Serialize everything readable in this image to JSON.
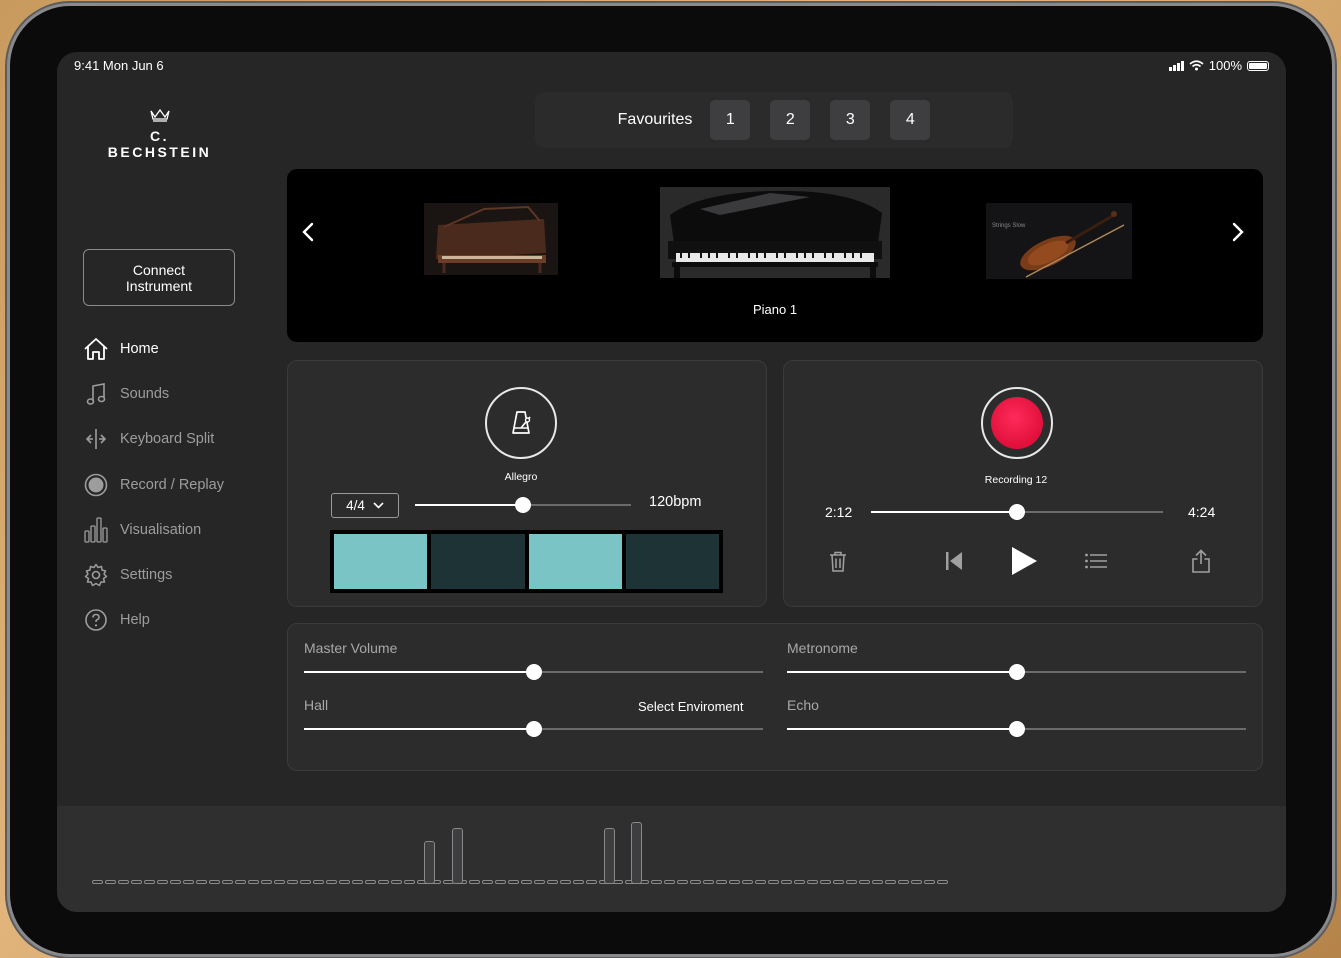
{
  "status": {
    "time": "9:41  Mon Jun 6",
    "battery": "100%"
  },
  "logo": {
    "brand": "C. BECHSTEIN"
  },
  "sidebar": {
    "connect_label": "Connect\nInstrument",
    "items": [
      {
        "label": "Home",
        "icon": "home-icon",
        "active": true
      },
      {
        "label": "Sounds",
        "icon": "music-note-icon"
      },
      {
        "label": "Keyboard Split",
        "icon": "split-icon"
      },
      {
        "label": "Record / Replay",
        "icon": "record-icon"
      },
      {
        "label": "Visualisation",
        "icon": "bars-icon"
      },
      {
        "label": "Settings",
        "icon": "gear-icon"
      },
      {
        "label": "Help",
        "icon": "help-icon"
      }
    ]
  },
  "favourites": {
    "label": "Favourites",
    "slots": [
      "1",
      "2",
      "3",
      "4"
    ]
  },
  "carousel": {
    "current_label": "Piano 1",
    "left_thumb_caption": "",
    "right_thumb_caption": "Strings Slow"
  },
  "metronome": {
    "tempo_name": "Allegro",
    "time_signature": "4/4",
    "bpm_label": "120bpm",
    "tempo_position": 0.5,
    "beats": [
      true,
      false,
      true,
      false
    ]
  },
  "recorder": {
    "name": "Recording 12",
    "elapsed": "2:12",
    "total": "4:24",
    "progress": 0.5
  },
  "mixer": {
    "master_volume": {
      "label": "Master Volume",
      "value": 0.5
    },
    "metronome": {
      "label": "Metronome",
      "value": 0.5
    },
    "hall": {
      "label": "Hall",
      "value": 0.5,
      "action": "Select Enviroment"
    },
    "echo": {
      "label": "Echo",
      "value": 0.5
    }
  },
  "visualisation": {
    "key_count": 66,
    "active_bars": [
      {
        "key": 24,
        "level": 0.7
      },
      {
        "key": 26,
        "level": 0.9
      },
      {
        "key": 37,
        "level": 0.9
      },
      {
        "key": 39,
        "level": 1.0
      }
    ]
  },
  "colors": {
    "accent": "#7ac4c6",
    "record": "#e8103a",
    "background": "#262627"
  }
}
